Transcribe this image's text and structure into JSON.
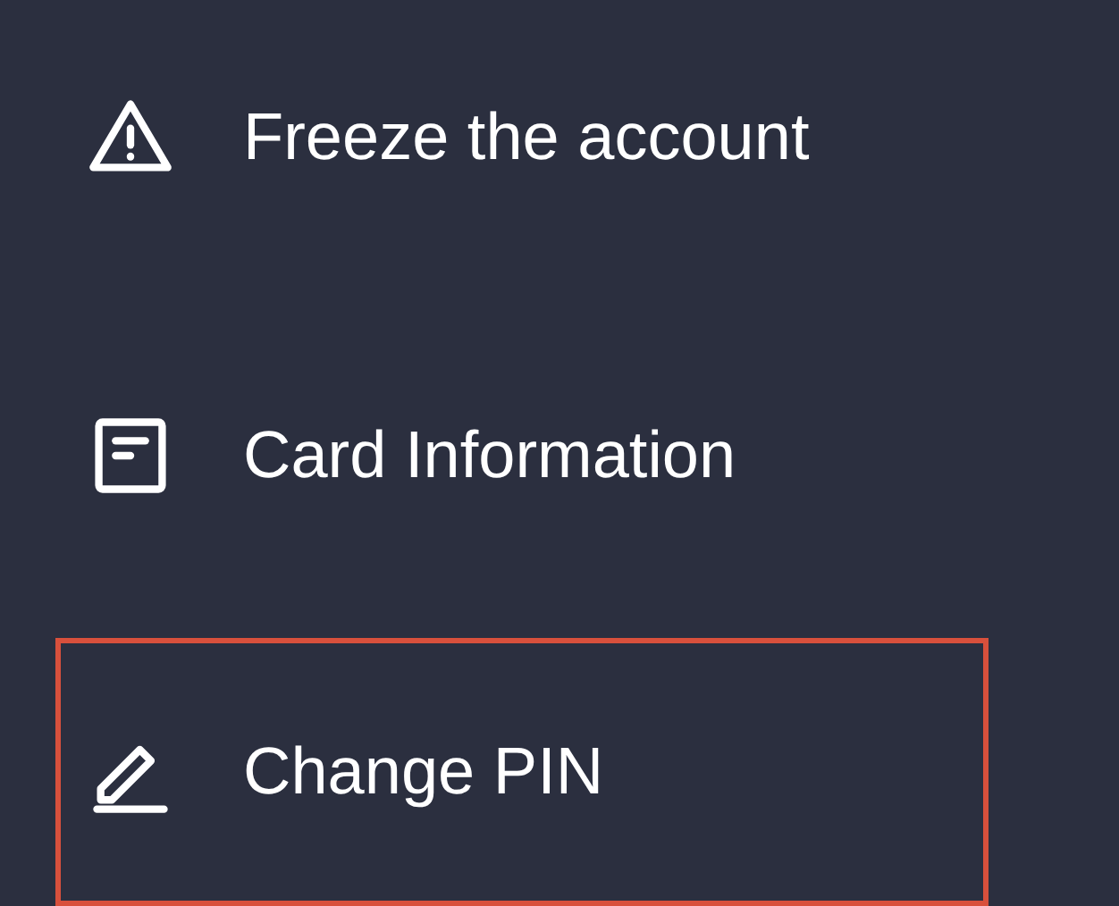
{
  "menu": {
    "items": [
      {
        "kind": "warning",
        "label": "Freeze the account",
        "highlighted": false
      },
      {
        "kind": "document",
        "label": "Card Information",
        "highlighted": false
      },
      {
        "kind": "pencil",
        "label": "Change PIN",
        "highlighted": true
      }
    ]
  }
}
